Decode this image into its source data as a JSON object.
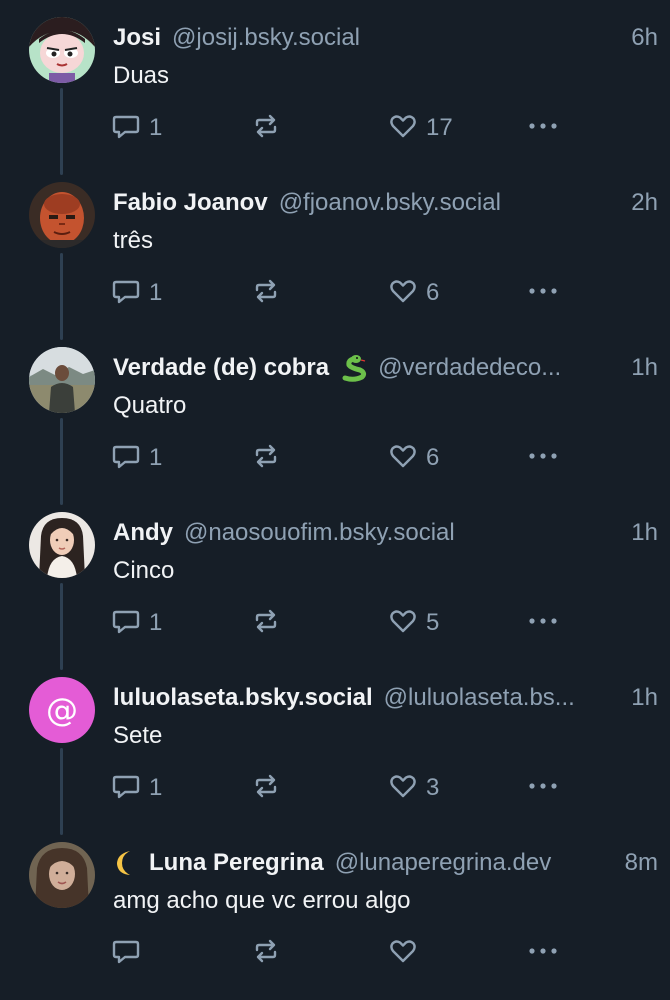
{
  "posts": [
    {
      "display_name": "Josi",
      "handle": "@josij.bsky.social",
      "time": "6h",
      "text": "Duas",
      "reply_count": "1",
      "like_count": "17",
      "avatar_kind": "cartoon"
    },
    {
      "display_name": "Fabio Joanov",
      "handle": "@fjoanov.bsky.social",
      "time": "2h",
      "text": "três",
      "reply_count": "1",
      "like_count": "6",
      "avatar_kind": "photo-red-face"
    },
    {
      "display_name": "Verdade (de) cobra",
      "name_emoji": "snake-emoji",
      "handle": "@verdadedeco...",
      "time": "1h",
      "text": "Quatro",
      "reply_count": "1",
      "like_count": "6",
      "avatar_kind": "photo-landscape"
    },
    {
      "display_name": "Andy",
      "handle": "@naosouofim.bsky.social",
      "time": "1h",
      "text": "Cinco",
      "reply_count": "1",
      "like_count": "5",
      "avatar_kind": "photo-woman"
    },
    {
      "display_name": "luluolaseta.bsky.social",
      "handle": "@luluolaseta.bs...",
      "time": "1h",
      "text": "Sete",
      "reply_count": "1",
      "like_count": "3",
      "avatar_kind": "at-sign-placeholder",
      "avatar_glyph": "@"
    },
    {
      "display_name": "Luna Peregrina",
      "name_prefix_emoji": "crescent-moon-emoji",
      "handle": "@lunaperegrina.dev",
      "time": "8m",
      "text": "amg acho que vc errou algo",
      "reply_count": "",
      "like_count": "",
      "avatar_kind": "photo-woman-2"
    }
  ],
  "colors": {
    "background": "#161e27",
    "text_primary": "#f1f3f5",
    "text_secondary": "#8fa1b3",
    "thread_line": "#2e4052",
    "placeholder_avatar": "#e45cd6"
  },
  "icons": [
    "reply-icon",
    "repost-icon",
    "like-icon",
    "more-options-icon",
    "snake-emoji",
    "crescent-moon-emoji"
  ]
}
